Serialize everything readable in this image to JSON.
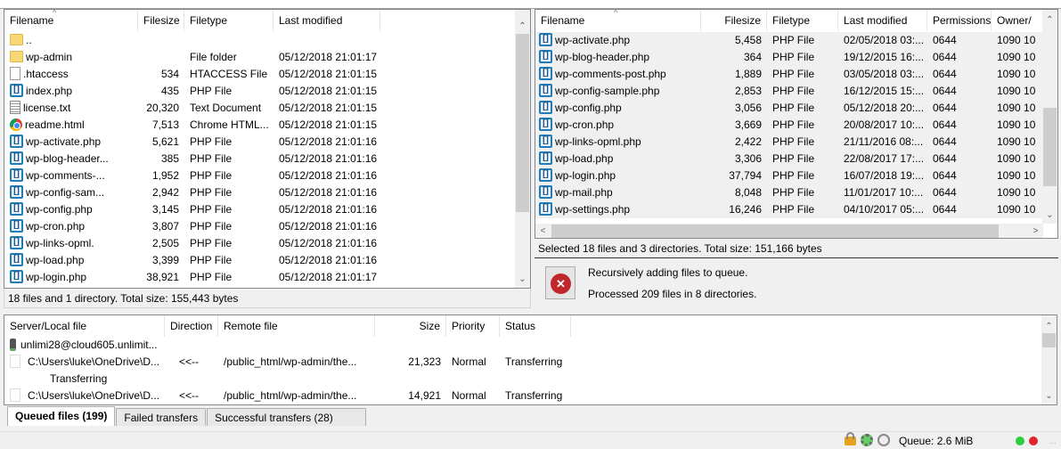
{
  "local": {
    "columns": [
      "Filename",
      "Filesize",
      "Filetype",
      "Last modified"
    ],
    "files": [
      {
        "name": "..",
        "size": "",
        "type": "",
        "modified": "",
        "icon": "folder"
      },
      {
        "name": "wp-admin",
        "size": "",
        "type": "File folder",
        "modified": "05/12/2018 21:01:17",
        "icon": "folder"
      },
      {
        "name": ".htaccess",
        "size": "534",
        "type": "HTACCESS File",
        "modified": "05/12/2018 21:01:15",
        "icon": "doc"
      },
      {
        "name": "index.php",
        "size": "435",
        "type": "PHP File",
        "modified": "05/12/2018 21:01:15",
        "icon": "php"
      },
      {
        "name": "license.txt",
        "size": "20,320",
        "type": "Text Document",
        "modified": "05/12/2018 21:01:15",
        "icon": "txt"
      },
      {
        "name": "readme.html",
        "size": "7,513",
        "type": "Chrome HTML...",
        "modified": "05/12/2018 21:01:15",
        "icon": "chrome"
      },
      {
        "name": "wp-activate.php",
        "size": "5,621",
        "type": "PHP File",
        "modified": "05/12/2018 21:01:16",
        "icon": "php"
      },
      {
        "name": "wp-blog-header...",
        "size": "385",
        "type": "PHP File",
        "modified": "05/12/2018 21:01:16",
        "icon": "php"
      },
      {
        "name": "wp-comments-...",
        "size": "1,952",
        "type": "PHP File",
        "modified": "05/12/2018 21:01:16",
        "icon": "php"
      },
      {
        "name": "wp-config-sam...",
        "size": "2,942",
        "type": "PHP File",
        "modified": "05/12/2018 21:01:16",
        "icon": "php"
      },
      {
        "name": "wp-config.php",
        "size": "3,145",
        "type": "PHP File",
        "modified": "05/12/2018 21:01:16",
        "icon": "php"
      },
      {
        "name": "wp-cron.php",
        "size": "3,807",
        "type": "PHP File",
        "modified": "05/12/2018 21:01:16",
        "icon": "php"
      },
      {
        "name": "wp-links-opml.",
        "size": "2,505",
        "type": "PHP File",
        "modified": "05/12/2018 21:01:16",
        "icon": "php"
      },
      {
        "name": "wp-load.php",
        "size": "3,399",
        "type": "PHP File",
        "modified": "05/12/2018 21:01:16",
        "icon": "php"
      },
      {
        "name": "wp-login.php",
        "size": "38,921",
        "type": "PHP File",
        "modified": "05/12/2018 21:01:17",
        "icon": "php"
      }
    ],
    "status": "18 files and 1 directory. Total size: 155,443 bytes"
  },
  "remote": {
    "columns": [
      "Filename",
      "Filesize",
      "Filetype",
      "Last modified",
      "Permissions",
      "Owner/"
    ],
    "files": [
      {
        "name": "wp-activate.php",
        "size": "5,458",
        "type": "PHP File",
        "modified": "02/05/2018 03:...",
        "perm": "0644",
        "owner": "1090 10"
      },
      {
        "name": "wp-blog-header.php",
        "size": "364",
        "type": "PHP File",
        "modified": "19/12/2015 16:...",
        "perm": "0644",
        "owner": "1090 10"
      },
      {
        "name": "wp-comments-post.php",
        "size": "1,889",
        "type": "PHP File",
        "modified": "03/05/2018 03:...",
        "perm": "0644",
        "owner": "1090 10"
      },
      {
        "name": "wp-config-sample.php",
        "size": "2,853",
        "type": "PHP File",
        "modified": "16/12/2015 15:...",
        "perm": "0644",
        "owner": "1090 10"
      },
      {
        "name": "wp-config.php",
        "size": "3,056",
        "type": "PHP File",
        "modified": "05/12/2018 20:...",
        "perm": "0644",
        "owner": "1090 10"
      },
      {
        "name": "wp-cron.php",
        "size": "3,669",
        "type": "PHP File",
        "modified": "20/08/2017 10:...",
        "perm": "0644",
        "owner": "1090 10"
      },
      {
        "name": "wp-links-opml.php",
        "size": "2,422",
        "type": "PHP File",
        "modified": "21/11/2016 08:...",
        "perm": "0644",
        "owner": "1090 10"
      },
      {
        "name": "wp-load.php",
        "size": "3,306",
        "type": "PHP File",
        "modified": "22/08/2017 17:...",
        "perm": "0644",
        "owner": "1090 10"
      },
      {
        "name": "wp-login.php",
        "size": "37,794",
        "type": "PHP File",
        "modified": "16/07/2018 19:...",
        "perm": "0644",
        "owner": "1090 10"
      },
      {
        "name": "wp-mail.php",
        "size": "8,048",
        "type": "PHP File",
        "modified": "11/01/2017 10:...",
        "perm": "0644",
        "owner": "1090 10"
      },
      {
        "name": "wp-settings.php",
        "size": "16,246",
        "type": "PHP File",
        "modified": "04/10/2017 05:...",
        "perm": "0644",
        "owner": "1090 10"
      }
    ],
    "status": "Selected 18 files and 3 directories. Total size: 151,166 bytes"
  },
  "notice": {
    "line1": "Recursively adding files to queue.",
    "line2": "Processed 209 files in 8 directories.",
    "icon": "error-cancel-icon"
  },
  "queue": {
    "columns": [
      "Server/Local file",
      "Direction",
      "Remote file",
      "Size",
      "Priority",
      "Status"
    ],
    "server": "unlimi28@cloud605.unlimit...",
    "items": [
      {
        "local": "C:\\Users\\luke\\OneDrive\\D...",
        "direction": "<<--",
        "remote": "/public_html/wp-admin/the...",
        "size": "21,323",
        "priority": "Normal",
        "status": "Transferring",
        "sub": "Transferring"
      },
      {
        "local": "C:\\Users\\luke\\OneDrive\\D...",
        "direction": "<<--",
        "remote": "/public_html/wp-admin/the...",
        "size": "14,921",
        "priority": "Normal",
        "status": "Transferring"
      }
    ]
  },
  "tabs": [
    {
      "label": "Queued files (199)",
      "active": true
    },
    {
      "label": "Failed transfers",
      "active": false
    },
    {
      "label": "Successful transfers (28)",
      "active": false
    }
  ],
  "statusbar": {
    "queue": "Queue: 2.6 MiB",
    "colors": {
      "green": "#2ecc40",
      "red": "#e0242a"
    }
  }
}
